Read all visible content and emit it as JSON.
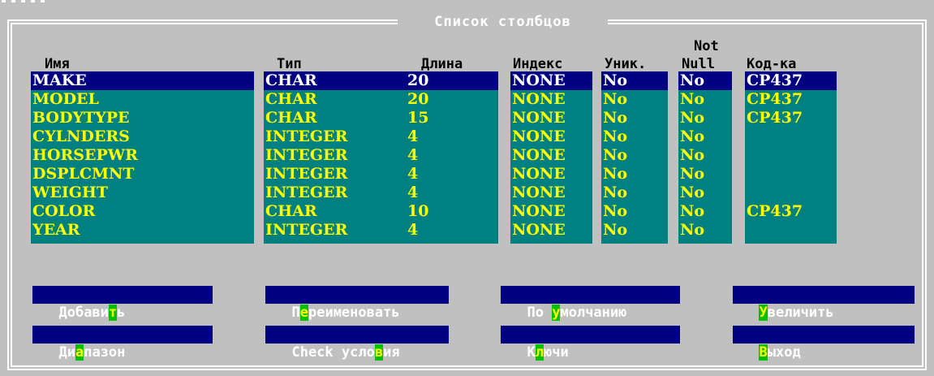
{
  "dialog": {
    "title": "Список столбцов"
  },
  "headers": {
    "name": "Имя",
    "type": "Тип",
    "length": "Длина",
    "index": "Индекс",
    "unique": "Уник.",
    "notnull_top": "Not",
    "notnull_bottom": "Null",
    "codepage": "Код-ка"
  },
  "rows": [
    {
      "name": "MAKE",
      "type": "CHAR",
      "length": "20",
      "index": "NONE",
      "unique": "No",
      "notnull": "No",
      "codepage": "CP437"
    },
    {
      "name": "MODEL",
      "type": "CHAR",
      "length": "20",
      "index": "NONE",
      "unique": "No",
      "notnull": "No",
      "codepage": "CP437"
    },
    {
      "name": "BODYTYPE",
      "type": "CHAR",
      "length": "15",
      "index": "NONE",
      "unique": "No",
      "notnull": "No",
      "codepage": "CP437"
    },
    {
      "name": "CYLNDERS",
      "type": "INTEGER",
      "length": "4",
      "index": "NONE",
      "unique": "No",
      "notnull": "No",
      "codepage": ""
    },
    {
      "name": "HORSEPWR",
      "type": "INTEGER",
      "length": "4",
      "index": "NONE",
      "unique": "No",
      "notnull": "No",
      "codepage": ""
    },
    {
      "name": "DSPLCMNT",
      "type": "INTEGER",
      "length": "4",
      "index": "NONE",
      "unique": "No",
      "notnull": "No",
      "codepage": ""
    },
    {
      "name": "WEIGHT",
      "type": "INTEGER",
      "length": "4",
      "index": "NONE",
      "unique": "No",
      "notnull": "No",
      "codepage": ""
    },
    {
      "name": "COLOR",
      "type": "CHAR",
      "length": "10",
      "index": "NONE",
      "unique": "No",
      "notnull": "No",
      "codepage": "CP437"
    },
    {
      "name": "YEAR",
      "type": "INTEGER",
      "length": "4",
      "index": "NONE",
      "unique": "No",
      "notnull": "No",
      "codepage": ""
    }
  ],
  "selected_row": 0,
  "buttons": {
    "add": {
      "pre": "Добави",
      "hot": "т",
      "post": "ь"
    },
    "rename": {
      "pre": "П",
      "hot": "е",
      "post": "реименовать"
    },
    "default": {
      "pre": "По ",
      "hot": "у",
      "post": "молчанию"
    },
    "enlarge": {
      "pre": "",
      "hot": "У",
      "post": "величить"
    },
    "range": {
      "pre": "Ди",
      "hot": "а",
      "post": "пазон"
    },
    "check": {
      "pre": "Check усло",
      "hot": "в",
      "post": "ия"
    },
    "keys": {
      "pre": "К",
      "hot": "л",
      "post": "ючи"
    },
    "exit": {
      "pre": "",
      "hot": "В",
      "post": "ыход"
    }
  },
  "colors": {
    "background": "#c0c0c0",
    "column_bg": "#008080",
    "cell_text": "#ffff00",
    "selected_bg": "#000080",
    "button_bg": "#000080",
    "hotkey_bg": "#00c000"
  }
}
